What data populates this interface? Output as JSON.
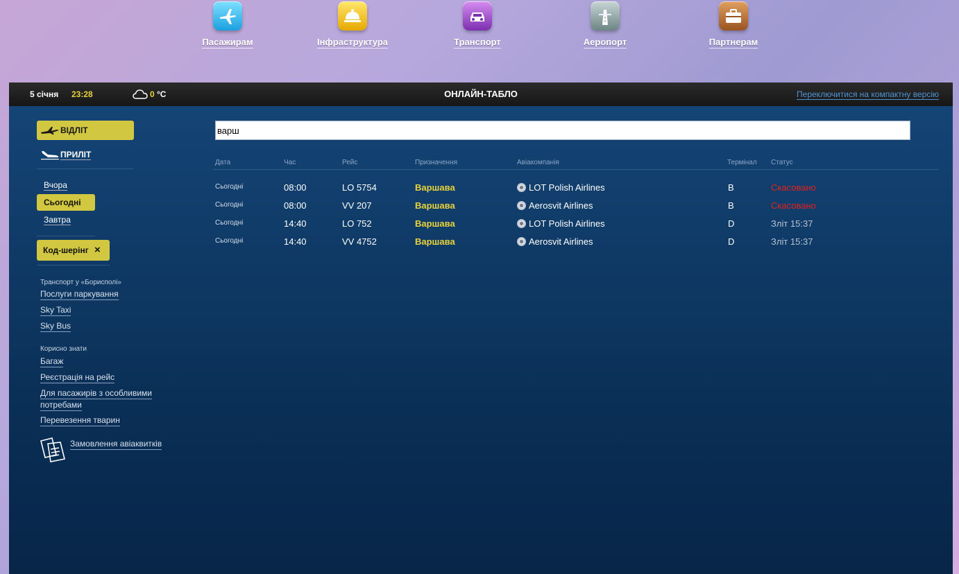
{
  "nav": [
    {
      "label": "Пасажирам",
      "icon": "airplane-icon",
      "color": "#1ba0e0"
    },
    {
      "label": "Інфраструктура",
      "icon": "cloche-icon",
      "color": "#e6a800"
    },
    {
      "label": "Транспорт",
      "icon": "car-icon",
      "color": "#7c2fb0"
    },
    {
      "label": "Аеропорт",
      "icon": "runway-icon",
      "color": "#6d8585"
    },
    {
      "label": "Партнерам",
      "icon": "briefcase-icon",
      "color": "#9a5420"
    }
  ],
  "header": {
    "date": "5 січня",
    "time": "23:28",
    "temp_value": "0",
    "temp_unit": "°C",
    "title": "ОНЛАЙН-ТАБЛО",
    "compact_link": "Переключитися на компактну версію"
  },
  "sidebar": {
    "departure": "ВІДЛІТ",
    "arrival": "ПРИЛІТ",
    "days": [
      "Вчора",
      "Сьогодні",
      "Завтра"
    ],
    "codeshare": "Код-шерінг",
    "codeshare_close": "×",
    "transport_title": "Транспорт у «Борисполі»",
    "transport_links": [
      "Послуги паркування",
      "Sky Taxi",
      "Sky Bus"
    ],
    "useful_title": "Корисно знати",
    "useful_links": [
      "Багаж",
      "Реєстрація на рейс",
      "Для пасажирів з особливими",
      "потребами",
      "Перевезення тварин"
    ],
    "tickets_link": "Замовлення авіаквитків"
  },
  "search": {
    "value": "варш"
  },
  "table": {
    "headers": [
      "Дата",
      "Час",
      "Рейс",
      "Призначення",
      "Авіакомпанія",
      "Термінал",
      "Статус"
    ],
    "rows": [
      {
        "date": "Сьогодні",
        "time": "08:00",
        "flight": "LO 5754",
        "dest": "Варшава",
        "airline": "LOT Polish Airlines",
        "terminal": "B",
        "status": "Скасовано"
      },
      {
        "date": "Сьогодні",
        "time": "08:00",
        "flight": "VV 207",
        "dest": "Варшава",
        "airline": "Aerosvit Airlines",
        "terminal": "B",
        "status": "Скасовано"
      },
      {
        "date": "Сьогодні",
        "time": "14:40",
        "flight": "LO 752",
        "dest": "Варшава",
        "airline": "LOT Polish Airlines",
        "terminal": "D",
        "status": "Зліт 15:37"
      },
      {
        "date": "Сьогодні",
        "time": "14:40",
        "flight": "VV 4752",
        "dest": "Варшава",
        "airline": "Aerosvit Airlines",
        "terminal": "D",
        "status": "Зліт 15:37"
      }
    ]
  },
  "colors": {
    "accent": "#d1c741",
    "cancel": "#e2211c",
    "dest": "#e8d23a"
  }
}
